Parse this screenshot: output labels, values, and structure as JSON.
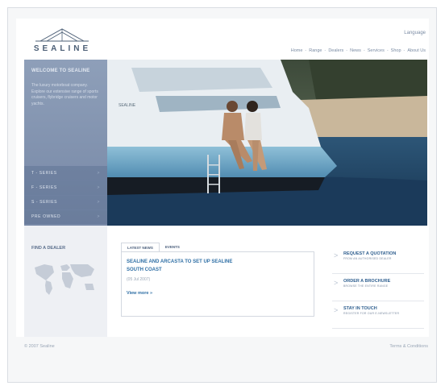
{
  "brand": {
    "name": "SEALINE"
  },
  "header": {
    "language_label": "Language",
    "nav": [
      "Home",
      "Range",
      "Dealers",
      "News",
      "Services",
      "Shop",
      "About Us"
    ],
    "nav_separator": "-"
  },
  "sidebar": {
    "title": "WELCOME TO SEALINE",
    "intro": "The luxury motorboat company. Explore our extensive range of sports cruisers, flybridge cruisers and motor yachts.",
    "series": [
      {
        "label": "T - SERIES",
        "arrow": ">"
      },
      {
        "label": "F - SERIES",
        "arrow": ">"
      },
      {
        "label": "S - SERIES",
        "arrow": ">"
      },
      {
        "label": "PRE OWNED",
        "arrow": ">"
      }
    ]
  },
  "hero": {
    "hull_text": "SEALINE"
  },
  "dealer": {
    "title": "FIND A DEALER"
  },
  "news": {
    "tabs": [
      "LATEST NEWS",
      "EVENTS"
    ],
    "headline": "SEALINE AND ARCASTA TO SET UP SEALINE SOUTH COAST",
    "date": "(05 Jul 2007)",
    "view_more": "View more »"
  },
  "actions": [
    {
      "title": "REQUEST A QUOTATION",
      "subtitle": "FROM AN AUTHORISED DEALER",
      "chevron": ">"
    },
    {
      "title": "ORDER A BROCHURE",
      "subtitle": "BROWSE THE ENTIRE RANGE",
      "chevron": ">"
    },
    {
      "title": "STAY IN TOUCH",
      "subtitle": "REGISTER FOR OUR E-NEWSLETTER",
      "chevron": ">"
    }
  ],
  "footer": {
    "copyright": "© 2007 Sealine",
    "terms": "Terms & Conditions"
  },
  "colors": {
    "accent": "#2f6fa5",
    "sidebar": "#8294b0",
    "nav": "#7a8ba3"
  }
}
